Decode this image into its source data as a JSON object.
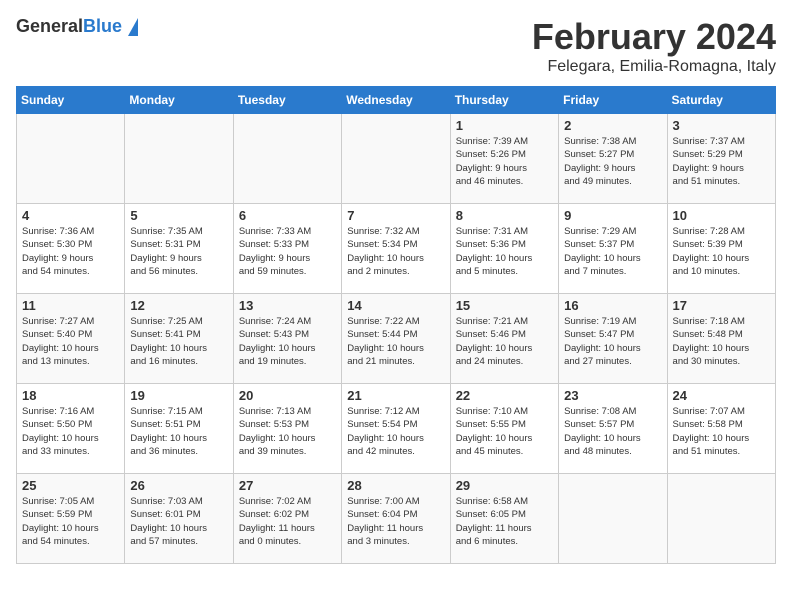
{
  "logo": {
    "general": "General",
    "blue": "Blue"
  },
  "title": "February 2024",
  "subtitle": "Felegara, Emilia-Romagna, Italy",
  "days_header": [
    "Sunday",
    "Monday",
    "Tuesday",
    "Wednesday",
    "Thursday",
    "Friday",
    "Saturday"
  ],
  "weeks": [
    [
      {
        "day": "",
        "info": ""
      },
      {
        "day": "",
        "info": ""
      },
      {
        "day": "",
        "info": ""
      },
      {
        "day": "",
        "info": ""
      },
      {
        "day": "1",
        "info": "Sunrise: 7:39 AM\nSunset: 5:26 PM\nDaylight: 9 hours\nand 46 minutes."
      },
      {
        "day": "2",
        "info": "Sunrise: 7:38 AM\nSunset: 5:27 PM\nDaylight: 9 hours\nand 49 minutes."
      },
      {
        "day": "3",
        "info": "Sunrise: 7:37 AM\nSunset: 5:29 PM\nDaylight: 9 hours\nand 51 minutes."
      }
    ],
    [
      {
        "day": "4",
        "info": "Sunrise: 7:36 AM\nSunset: 5:30 PM\nDaylight: 9 hours\nand 54 minutes."
      },
      {
        "day": "5",
        "info": "Sunrise: 7:35 AM\nSunset: 5:31 PM\nDaylight: 9 hours\nand 56 minutes."
      },
      {
        "day": "6",
        "info": "Sunrise: 7:33 AM\nSunset: 5:33 PM\nDaylight: 9 hours\nand 59 minutes."
      },
      {
        "day": "7",
        "info": "Sunrise: 7:32 AM\nSunset: 5:34 PM\nDaylight: 10 hours\nand 2 minutes."
      },
      {
        "day": "8",
        "info": "Sunrise: 7:31 AM\nSunset: 5:36 PM\nDaylight: 10 hours\nand 5 minutes."
      },
      {
        "day": "9",
        "info": "Sunrise: 7:29 AM\nSunset: 5:37 PM\nDaylight: 10 hours\nand 7 minutes."
      },
      {
        "day": "10",
        "info": "Sunrise: 7:28 AM\nSunset: 5:39 PM\nDaylight: 10 hours\nand 10 minutes."
      }
    ],
    [
      {
        "day": "11",
        "info": "Sunrise: 7:27 AM\nSunset: 5:40 PM\nDaylight: 10 hours\nand 13 minutes."
      },
      {
        "day": "12",
        "info": "Sunrise: 7:25 AM\nSunset: 5:41 PM\nDaylight: 10 hours\nand 16 minutes."
      },
      {
        "day": "13",
        "info": "Sunrise: 7:24 AM\nSunset: 5:43 PM\nDaylight: 10 hours\nand 19 minutes."
      },
      {
        "day": "14",
        "info": "Sunrise: 7:22 AM\nSunset: 5:44 PM\nDaylight: 10 hours\nand 21 minutes."
      },
      {
        "day": "15",
        "info": "Sunrise: 7:21 AM\nSunset: 5:46 PM\nDaylight: 10 hours\nand 24 minutes."
      },
      {
        "day": "16",
        "info": "Sunrise: 7:19 AM\nSunset: 5:47 PM\nDaylight: 10 hours\nand 27 minutes."
      },
      {
        "day": "17",
        "info": "Sunrise: 7:18 AM\nSunset: 5:48 PM\nDaylight: 10 hours\nand 30 minutes."
      }
    ],
    [
      {
        "day": "18",
        "info": "Sunrise: 7:16 AM\nSunset: 5:50 PM\nDaylight: 10 hours\nand 33 minutes."
      },
      {
        "day": "19",
        "info": "Sunrise: 7:15 AM\nSunset: 5:51 PM\nDaylight: 10 hours\nand 36 minutes."
      },
      {
        "day": "20",
        "info": "Sunrise: 7:13 AM\nSunset: 5:53 PM\nDaylight: 10 hours\nand 39 minutes."
      },
      {
        "day": "21",
        "info": "Sunrise: 7:12 AM\nSunset: 5:54 PM\nDaylight: 10 hours\nand 42 minutes."
      },
      {
        "day": "22",
        "info": "Sunrise: 7:10 AM\nSunset: 5:55 PM\nDaylight: 10 hours\nand 45 minutes."
      },
      {
        "day": "23",
        "info": "Sunrise: 7:08 AM\nSunset: 5:57 PM\nDaylight: 10 hours\nand 48 minutes."
      },
      {
        "day": "24",
        "info": "Sunrise: 7:07 AM\nSunset: 5:58 PM\nDaylight: 10 hours\nand 51 minutes."
      }
    ],
    [
      {
        "day": "25",
        "info": "Sunrise: 7:05 AM\nSunset: 5:59 PM\nDaylight: 10 hours\nand 54 minutes."
      },
      {
        "day": "26",
        "info": "Sunrise: 7:03 AM\nSunset: 6:01 PM\nDaylight: 10 hours\nand 57 minutes."
      },
      {
        "day": "27",
        "info": "Sunrise: 7:02 AM\nSunset: 6:02 PM\nDaylight: 11 hours\nand 0 minutes."
      },
      {
        "day": "28",
        "info": "Sunrise: 7:00 AM\nSunset: 6:04 PM\nDaylight: 11 hours\nand 3 minutes."
      },
      {
        "day": "29",
        "info": "Sunrise: 6:58 AM\nSunset: 6:05 PM\nDaylight: 11 hours\nand 6 minutes."
      },
      {
        "day": "",
        "info": ""
      },
      {
        "day": "",
        "info": ""
      }
    ]
  ]
}
